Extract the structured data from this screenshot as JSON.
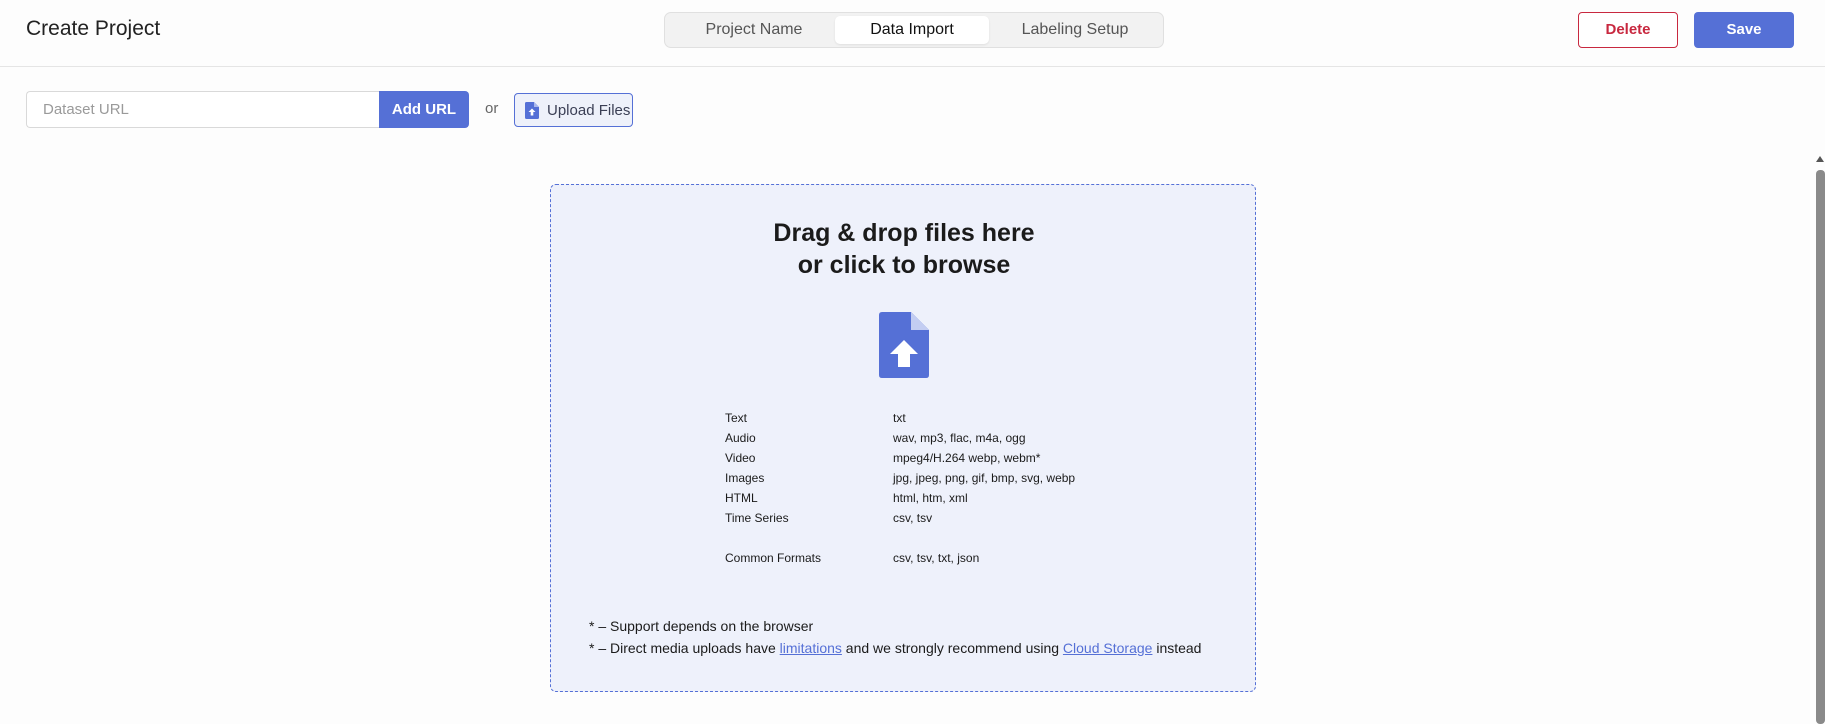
{
  "header": {
    "title": "Create Project",
    "steps": [
      "Project Name",
      "Data Import",
      "Labeling Setup"
    ],
    "active_step": "Data Import",
    "delete_label": "Delete",
    "save_label": "Save"
  },
  "import": {
    "url_placeholder": "Dataset URL",
    "add_url_label": "Add URL",
    "or_text": "or",
    "upload_label": "Upload Files"
  },
  "dropzone": {
    "heading_line1": "Drag & drop files here",
    "heading_line2": "or click to browse",
    "formats": [
      {
        "type": "Text",
        "ext": "txt"
      },
      {
        "type": "Audio",
        "ext": "wav, mp3, flac, m4a, ogg"
      },
      {
        "type": "Video",
        "ext": "mpeg4/H.264 webp, webm*"
      },
      {
        "type": "Images",
        "ext": "jpg, jpeg, png, gif, bmp, svg, webp"
      },
      {
        "type": "HTML",
        "ext": "html, htm, xml"
      },
      {
        "type": "Time Series",
        "ext": "csv, tsv"
      },
      {
        "type": "Common Formats",
        "ext": "csv, tsv, txt, json"
      }
    ],
    "note1": "* – Support depends on the browser",
    "note2_prefix": "* – Direct media uploads have ",
    "note2_link1": "limitations",
    "note2_middle": " and we strongly recommend using ",
    "note2_link2": "Cloud Storage",
    "note2_suffix": " instead"
  },
  "colors": {
    "accent": "#5570d6",
    "danger": "#c8283f",
    "dropzone_bg": "#eef1fb"
  },
  "icons": {
    "upload_button_icon": "file-upload-icon",
    "dropzone_icon": "file-upload-icon"
  }
}
